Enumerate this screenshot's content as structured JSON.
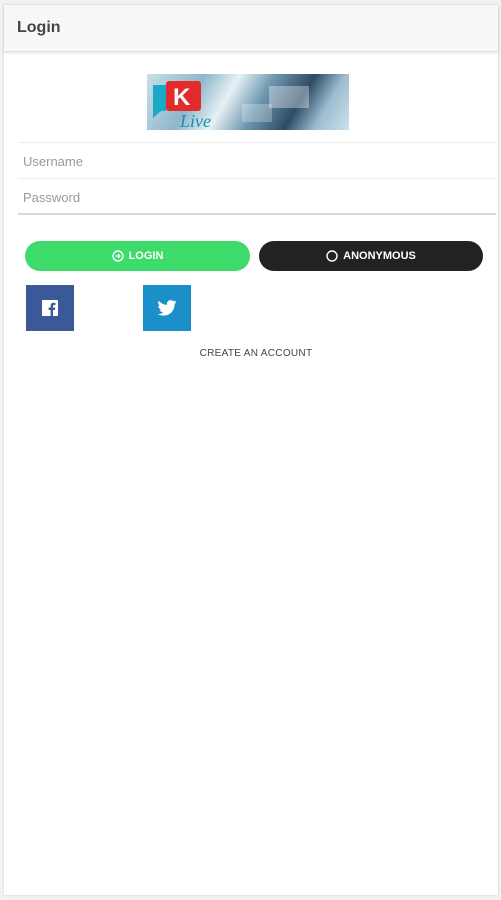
{
  "header": {
    "title": "Login"
  },
  "logo": {
    "letter": "K",
    "text": "Live"
  },
  "form": {
    "username_placeholder": "Username",
    "password_placeholder": "Password"
  },
  "buttons": {
    "login_label": "LOGIN",
    "anonymous_label": "ANONYMOUS"
  },
  "social": {
    "facebook_icon": "facebook-icon",
    "twitter_icon": "twitter-icon"
  },
  "links": {
    "create_account": "CREATE AN ACCOUNT"
  },
  "colors": {
    "login": "#3ddc6a",
    "anonymous": "#222222",
    "facebook": "#3b5998",
    "twitter": "#1b8fc9",
    "logo_red": "#e32b2b",
    "logo_teal": "#1aa9c7"
  }
}
